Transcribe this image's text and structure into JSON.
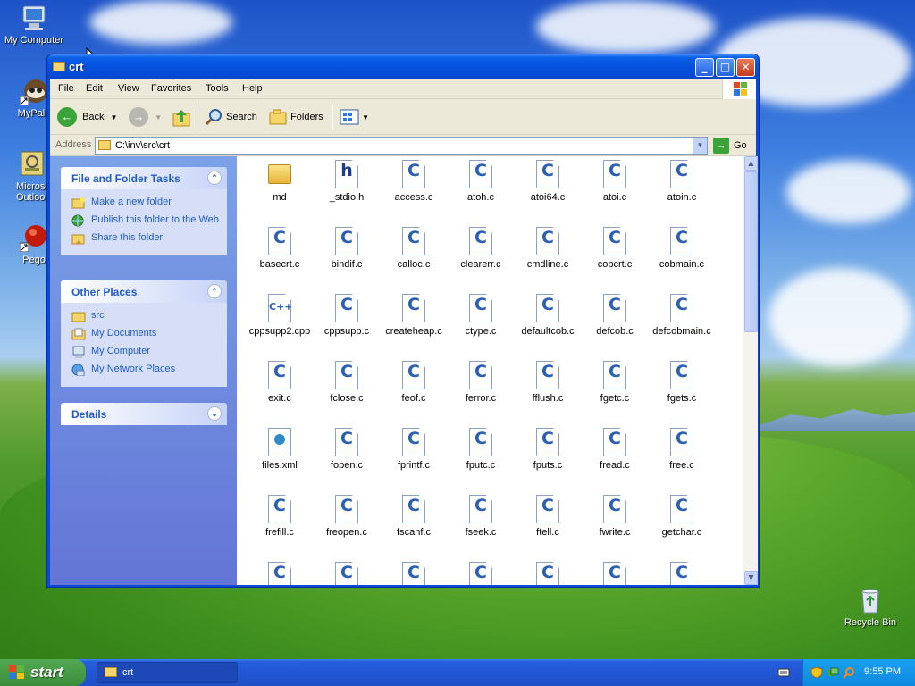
{
  "desktop": {
    "icons": [
      {
        "label": "My Computer"
      },
      {
        "label": "MyPal t"
      },
      {
        "label": "Microso Outloo"
      },
      {
        "label": "Pego"
      },
      {
        "label": "Recycle Bin"
      }
    ]
  },
  "window": {
    "title": "crt",
    "menu": [
      "File",
      "Edit",
      "View",
      "Favorites",
      "Tools",
      "Help"
    ],
    "toolbar": {
      "back": "Back",
      "search": "Search",
      "folders": "Folders"
    },
    "address": {
      "label": "Address",
      "value": "C:\\inv\\src\\crt",
      "go": "Go"
    },
    "tasks_panel": {
      "title": "File and Folder Tasks",
      "items": [
        "Make a new folder",
        "Publish this folder to the Web",
        "Share this folder"
      ]
    },
    "places_panel": {
      "title": "Other Places",
      "items": [
        "src",
        "My Documents",
        "My Computer",
        "My Network Places"
      ]
    },
    "details_panel": {
      "title": "Details"
    },
    "files": [
      {
        "name": "md",
        "type": "folder"
      },
      {
        "name": "_stdio.h",
        "type": "h"
      },
      {
        "name": "access.c",
        "type": "c"
      },
      {
        "name": "atoh.c",
        "type": "c"
      },
      {
        "name": "atoi64.c",
        "type": "c"
      },
      {
        "name": "atoi.c",
        "type": "c"
      },
      {
        "name": "atoin.c",
        "type": "c"
      },
      {
        "name": "basecrt.c",
        "type": "c"
      },
      {
        "name": "bindif.c",
        "type": "c"
      },
      {
        "name": "calloc.c",
        "type": "c"
      },
      {
        "name": "clearerr.c",
        "type": "c"
      },
      {
        "name": "cmdline.c",
        "type": "c"
      },
      {
        "name": "cobcrt.c",
        "type": "c"
      },
      {
        "name": "cobmain.c",
        "type": "c"
      },
      {
        "name": "cppsupp2.cpp",
        "type": "cpp"
      },
      {
        "name": "cppsupp.c",
        "type": "c"
      },
      {
        "name": "createheap.c",
        "type": "c"
      },
      {
        "name": "ctype.c",
        "type": "c"
      },
      {
        "name": "defaultcob.c",
        "type": "c"
      },
      {
        "name": "defcob.c",
        "type": "c"
      },
      {
        "name": "defcobmain.c",
        "type": "c"
      },
      {
        "name": "exit.c",
        "type": "c"
      },
      {
        "name": "fclose.c",
        "type": "c"
      },
      {
        "name": "feof.c",
        "type": "c"
      },
      {
        "name": "ferror.c",
        "type": "c"
      },
      {
        "name": "fflush.c",
        "type": "c"
      },
      {
        "name": "fgetc.c",
        "type": "c"
      },
      {
        "name": "fgets.c",
        "type": "c"
      },
      {
        "name": "files.xml",
        "type": "xml"
      },
      {
        "name": "fopen.c",
        "type": "c"
      },
      {
        "name": "fprintf.c",
        "type": "c"
      },
      {
        "name": "fputc.c",
        "type": "c"
      },
      {
        "name": "fputs.c",
        "type": "c"
      },
      {
        "name": "fread.c",
        "type": "c"
      },
      {
        "name": "free.c",
        "type": "c"
      },
      {
        "name": "frefill.c",
        "type": "c"
      },
      {
        "name": "freopen.c",
        "type": "c"
      },
      {
        "name": "fscanf.c",
        "type": "c"
      },
      {
        "name": "fseek.c",
        "type": "c"
      },
      {
        "name": "ftell.c",
        "type": "c"
      },
      {
        "name": "fwrite.c",
        "type": "c"
      },
      {
        "name": "getchar.c",
        "type": "c"
      },
      {
        "name": "",
        "type": "c"
      },
      {
        "name": "",
        "type": "c"
      },
      {
        "name": "",
        "type": "c"
      },
      {
        "name": "",
        "type": "c"
      },
      {
        "name": "",
        "type": "c"
      },
      {
        "name": "",
        "type": "c"
      },
      {
        "name": "",
        "type": "c"
      }
    ]
  },
  "taskbar": {
    "start_label": "start",
    "task_crt": "crt",
    "clock": "9:55 PM"
  }
}
